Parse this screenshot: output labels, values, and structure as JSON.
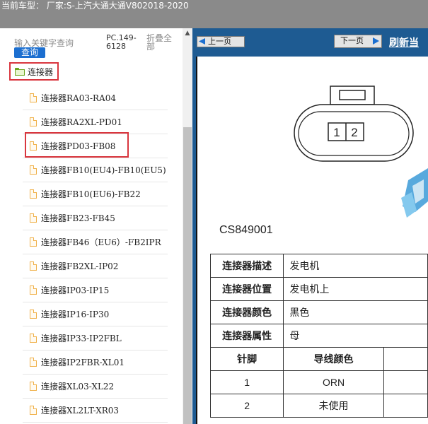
{
  "header": {
    "title": "当前车型： 厂家:S-上汽大通大通V802018-2020"
  },
  "sidebar": {
    "search_placeholder": "输入关键字查询",
    "search_button": "查询",
    "pc_label": "PC.149-6128",
    "collapse_label": "折叠全部",
    "root_label": "连接器",
    "items": [
      "连接器RA03-RA04",
      "连接器RA2XL-PD01",
      "连接器PD03-FB08",
      "连接器FB10(EU4)-FB10(EU5)",
      "连接器FB10(EU6)-FB22",
      "连接器FB23-FB45",
      "连接器FB46（EU6）-FB2IPR",
      "连接器FB2XL-IP02",
      "连接器IP03-IP15",
      "连接器IP16-IP30",
      "连接器IP33-IP2FBL",
      "连接器IP2FBR-XL01",
      "连接器XL03-XL22",
      "连接器XL2LT-XR03"
    ]
  },
  "nav": {
    "prev": "上一页",
    "next": "下一页",
    "refresh": "刷新当"
  },
  "diagram": {
    "pin1": "1",
    "pin2": "2",
    "code": "CS849001"
  },
  "info": {
    "rows": [
      {
        "key": "连接器描述",
        "value": "发电机"
      },
      {
        "key": "连接器位置",
        "value": "发电机上"
      },
      {
        "key": "连接器颜色",
        "value": "黑色"
      },
      {
        "key": "连接器属性",
        "value": "母"
      }
    ],
    "pin_header": {
      "pin": "针脚",
      "color": "导线颜色"
    },
    "pins": [
      {
        "pin": "1",
        "color": "ORN"
      },
      {
        "pin": "2",
        "color": "未使用"
      }
    ]
  }
}
